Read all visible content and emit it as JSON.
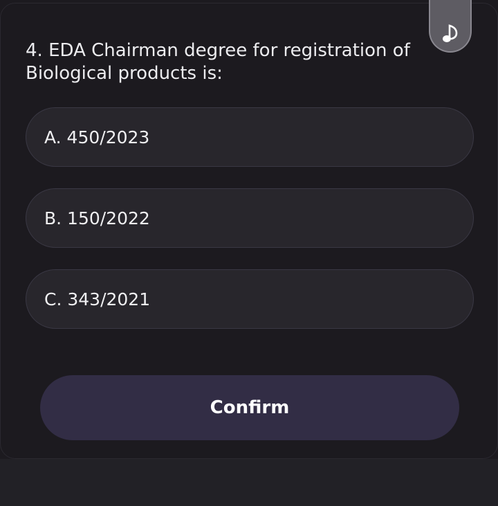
{
  "question": {
    "text": "4. EDA Chairman degree for registration of Biological products is:"
  },
  "options": [
    {
      "label": "A. 450/2023"
    },
    {
      "label": "B. 150/2022"
    },
    {
      "label": "C. 343/2021"
    }
  ],
  "confirm": {
    "label": "Confirm"
  },
  "music_toggle": {
    "icon": "music-note-icon"
  },
  "colors": {
    "background": "#1c1a1f",
    "option_fill": "#28262c",
    "option_border": "#3a3844",
    "confirm_fill": "#322d45",
    "text": "#ececef"
  }
}
